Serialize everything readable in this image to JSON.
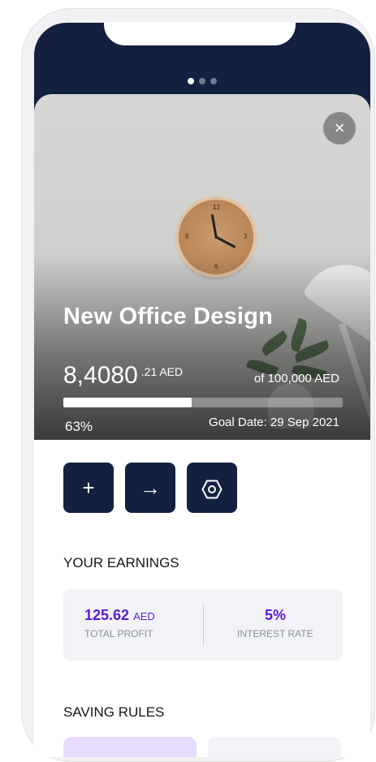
{
  "header": {
    "pager": {
      "count": 3,
      "active": 0
    }
  },
  "goal": {
    "title": "New Office Design",
    "amount": "8,4080",
    "amount_decimal": ".21 AED",
    "target": "of 100,000 AED",
    "progress_percent_value": 63,
    "percent_label": "63%",
    "goal_date": "Goal Date: 29 Sep 2021"
  },
  "close": {
    "symbol": "×"
  },
  "actions": [
    {
      "name": "add",
      "glyph": "+"
    },
    {
      "name": "transfer",
      "glyph": "→"
    },
    {
      "name": "settings",
      "glyph": "⬡"
    }
  ],
  "earnings": {
    "title": "YOUR EARNINGS",
    "total_profit_value": "125.62",
    "total_profit_unit": "AED",
    "total_profit_label": "TOTAL PROFIT",
    "interest_rate_value": "5%",
    "interest_rate_label": "INTEREST RATE"
  },
  "saving_rules": {
    "title": "SAVING RULES"
  },
  "colors": {
    "navy": "#13203f",
    "accent_purple": "#5b1ad9",
    "rule_card_purple": "#e7dcfd",
    "card_bg": "#f2f3f7"
  },
  "icons": {
    "close": "close-icon",
    "add": "plus-icon",
    "transfer": "arrow-right-icon",
    "settings": "hexagon-settings-icon"
  }
}
